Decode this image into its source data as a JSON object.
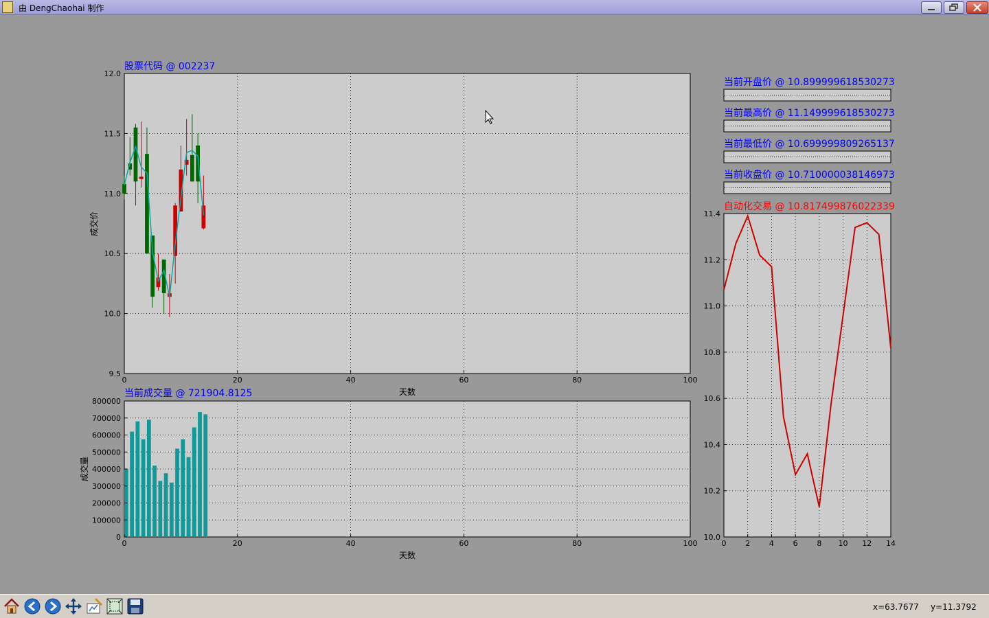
{
  "window": {
    "title": "由 DengChaohai 制作"
  },
  "panels": {
    "candle_title": "股票代码 @ 002237",
    "volume_title": "当前成交量 @ 721904.8125",
    "open_title": "当前开盘价 @ 10.899999618530273",
    "high_title": "当前最高价 @ 11.149999618530273",
    "low_title": "当前最低价 @ 10.699999809265137",
    "close_title": "当前收盘价 @ 10.710000038146973",
    "auto_title": "自动化交易 @ 10.817499876022339"
  },
  "colors": {
    "up": "#cc0000",
    "down": "#006600",
    "ma": "#00aaaa",
    "volume_bar": "#119999",
    "auto_line": "#cc0000",
    "title_blue": "#0000ff",
    "title_red": "#ff0000"
  },
  "toolbar": {
    "icons": [
      "home-icon",
      "back-icon",
      "forward-icon",
      "pan-icon",
      "configure-subplots-icon",
      "zoom-icon",
      "save-icon"
    ],
    "x_readout": "x=63.7677",
    "y_readout": "y=11.3792"
  },
  "chart_data": [
    {
      "type": "candlestick",
      "xlabel": "天数",
      "ylabel": "成交价",
      "xlim": [
        0,
        100
      ],
      "ylim": [
        9.5,
        12.0
      ],
      "xticks": [
        "0",
        "20",
        "40",
        "60",
        "80",
        "100"
      ],
      "yticks": [
        "9.5",
        "10.0",
        "10.5",
        "11.0",
        "11.5",
        "12.0"
      ],
      "grid": true,
      "candles": [
        {
          "x": 0,
          "open": 11.08,
          "close": 11.0,
          "high": 11.15,
          "low": 10.95
        },
        {
          "x": 1,
          "open": 11.25,
          "close": 11.2,
          "high": 11.47,
          "low": 11.15
        },
        {
          "x": 2,
          "open": 11.55,
          "close": 11.1,
          "high": 11.58,
          "low": 10.9
        },
        {
          "x": 3,
          "open": 11.12,
          "close": 11.14,
          "high": 11.6,
          "low": 11.05
        },
        {
          "x": 4,
          "open": 11.33,
          "close": 10.5,
          "high": 11.55,
          "low": 10.5
        },
        {
          "x": 5,
          "open": 10.65,
          "close": 10.14,
          "high": 10.65,
          "low": 10.05
        },
        {
          "x": 6,
          "open": 10.22,
          "close": 10.3,
          "high": 10.5,
          "low": 10.19
        },
        {
          "x": 7,
          "open": 10.45,
          "close": 10.17,
          "high": 10.45,
          "low": 10.0
        },
        {
          "x": 8,
          "open": 10.14,
          "close": 10.17,
          "high": 10.33,
          "low": 9.97
        },
        {
          "x": 9,
          "open": 10.48,
          "close": 10.9,
          "high": 10.92,
          "low": 10.25
        },
        {
          "x": 10,
          "open": 10.85,
          "close": 11.2,
          "high": 11.4,
          "low": 10.85
        },
        {
          "x": 11,
          "open": 11.24,
          "close": 11.28,
          "high": 11.62,
          "low": 11.15
        },
        {
          "x": 12,
          "open": 11.32,
          "close": 11.1,
          "high": 11.66,
          "low": 11.1
        },
        {
          "x": 13,
          "open": 11.4,
          "close": 11.1,
          "high": 11.5,
          "low": 10.92
        },
        {
          "x": 14,
          "open": 10.71,
          "close": 10.9,
          "high": 11.15,
          "low": 10.7
        }
      ],
      "moving_average": [
        11.07,
        11.26,
        11.39,
        11.22,
        11.17,
        10.51,
        10.27,
        10.36,
        10.14,
        10.58,
        10.96,
        11.34,
        11.36,
        11.31,
        10.82
      ]
    },
    {
      "type": "bar",
      "xlabel": "天数",
      "ylabel": "成交量",
      "xlim": [
        0,
        100
      ],
      "ylim": [
        0,
        800000
      ],
      "xticks": [
        "0",
        "20",
        "40",
        "60",
        "80",
        "100"
      ],
      "yticks": [
        "0",
        "100000",
        "200000",
        "300000",
        "400000",
        "500000",
        "600000",
        "700000",
        "800000"
      ],
      "grid": true,
      "x": [
        0,
        1,
        2,
        3,
        4,
        5,
        6,
        7,
        8,
        9,
        10,
        11,
        12,
        13,
        14
      ],
      "values": [
        400000,
        620000,
        680000,
        575000,
        690000,
        420000,
        330000,
        375000,
        320000,
        520000,
        575000,
        470000,
        645000,
        735000,
        721904.8125
      ]
    },
    {
      "type": "line",
      "xlabel": "",
      "ylabel": "",
      "xlim": [
        0,
        14
      ],
      "ylim": [
        10.0,
        11.4
      ],
      "xticks": [
        "0",
        "2",
        "4",
        "6",
        "8",
        "10",
        "12",
        "14"
      ],
      "yticks": [
        "10.0",
        "10.2",
        "10.4",
        "10.6",
        "10.8",
        "11.0",
        "11.2",
        "11.4"
      ],
      "grid": true,
      "x": [
        0,
        1,
        2,
        3,
        4,
        5,
        6,
        7,
        8,
        9,
        10,
        11,
        12,
        13,
        14
      ],
      "values": [
        11.07,
        11.27,
        11.39,
        11.22,
        11.17,
        10.52,
        10.27,
        10.36,
        10.13,
        10.58,
        10.96,
        11.34,
        11.36,
        11.31,
        10.8175
      ]
    },
    {
      "type": "bar",
      "role": "open",
      "grid": true
    },
    {
      "type": "bar",
      "role": "high",
      "grid": true
    },
    {
      "type": "bar",
      "role": "low",
      "grid": true
    },
    {
      "type": "bar",
      "role": "close",
      "grid": true
    }
  ]
}
